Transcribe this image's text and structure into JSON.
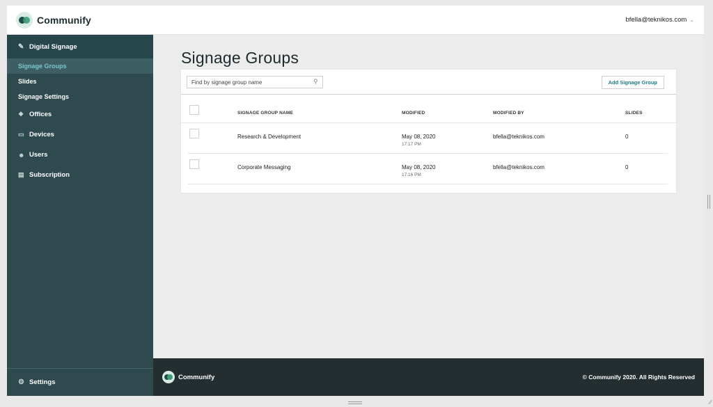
{
  "header": {
    "brand": "Communify",
    "user_email": "bfella@teknikos.com"
  },
  "sidebar": {
    "section_label": "Digital Signage",
    "sub_items": [
      {
        "label": "Signage Groups",
        "active": true
      },
      {
        "label": "Slides",
        "active": false
      },
      {
        "label": "Signage Settings",
        "active": false
      }
    ],
    "items": [
      {
        "label": "Offices",
        "icon": "offices-icon"
      },
      {
        "label": "Devices",
        "icon": "devices-icon"
      },
      {
        "label": "Users",
        "icon": "users-icon"
      },
      {
        "label": "Subscription",
        "icon": "subscription-icon"
      }
    ],
    "settings_label": "Settings"
  },
  "main": {
    "title": "Signage Groups",
    "search_placeholder": "Find by signage group name",
    "add_button_label": "Add Signage Group",
    "columns": [
      "SIGNAGE GROUP NAME",
      "MODIFIED",
      "MODIFIED BY",
      "SLIDES"
    ],
    "rows": [
      {
        "name": "Research & Development",
        "modified_date": "May 08, 2020",
        "modified_time": "17:17 PM",
        "modified_by": "bfella@teknikos.com",
        "slides": "0"
      },
      {
        "name": "Corporate Messaging",
        "modified_date": "May 08, 2020",
        "modified_time": "17:16 PM",
        "modified_by": "bfella@teknikos.com",
        "slides": "0"
      }
    ]
  },
  "footer": {
    "brand": "Communify",
    "copyright": "© Communify 2020. All Rights Reserved"
  },
  "colors": {
    "sidebar_bg": "#2e4a4f",
    "active_item_text": "#7cc7cf",
    "accent": "#1c7b86",
    "footer_bg": "#242e30"
  }
}
